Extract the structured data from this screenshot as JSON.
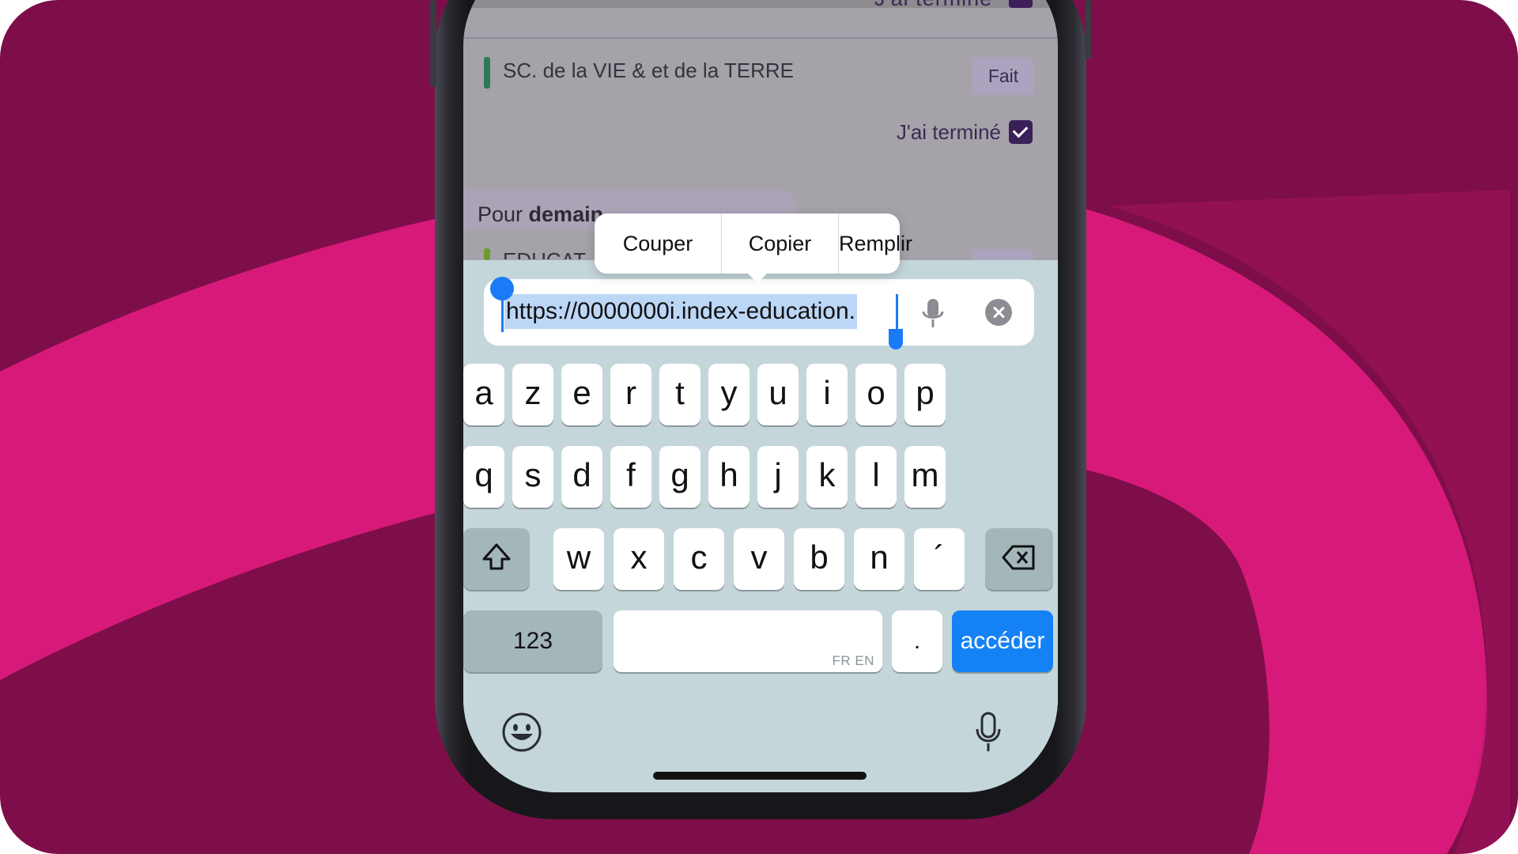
{
  "app_content": {
    "previous_done_label": "J'ai terminé",
    "subject_title": "SC. de la VIE & et de la TERRE",
    "status_badge": "Fait",
    "done_label": "J'ai terminé",
    "section_prefix": "Pour ",
    "section_bold": "demain",
    "next_subject": "EDUCAT",
    "subject_color": "#2e7a52",
    "next_subject_color": "#6f9a2c"
  },
  "context_menu": {
    "items": [
      "Couper",
      "Copier",
      "Remplir"
    ]
  },
  "url_field": {
    "value": "https://0000000i.index-education."
  },
  "keyboard": {
    "row1": [
      "a",
      "z",
      "e",
      "r",
      "t",
      "y",
      "u",
      "i",
      "o",
      "p"
    ],
    "row2": [
      "q",
      "s",
      "d",
      "f",
      "g",
      "h",
      "j",
      "k",
      "l",
      "m"
    ],
    "row3": [
      "w",
      "x",
      "c",
      "v",
      "b",
      "n",
      "´"
    ],
    "numbers_key": "123",
    "period_key": ".",
    "space_languages": "FR EN",
    "go_key": "accéder"
  },
  "icons": {
    "shift": "shift-icon",
    "delete": "delete-icon",
    "emoji": "emoji-icon",
    "mic": "mic-icon",
    "clear": "clear-icon"
  },
  "colors": {
    "background_dark": "#7e0e49",
    "background_accent": "#d71a7a",
    "selection_handle": "#1b7bf6",
    "go_key": "#1482f5"
  }
}
